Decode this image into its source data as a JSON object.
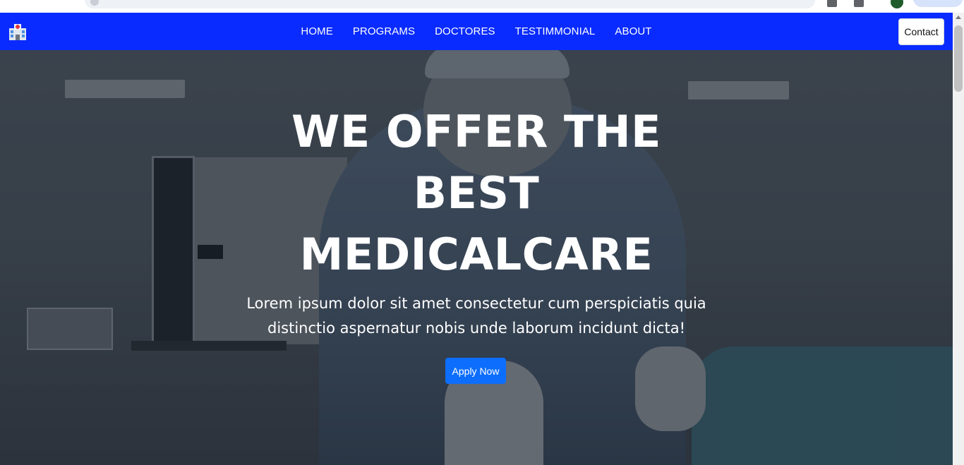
{
  "navbar": {
    "brand_icon": "hospital-icon",
    "links": [
      "HOME",
      "PROGRAMS",
      "DOCTORES",
      "TESTIMMONIAL",
      "ABOUT"
    ],
    "contact_label": "Contact",
    "background": "#0a2bff"
  },
  "hero": {
    "title": "WE OFFER THE BEST MEDICALCARE",
    "text": "Lorem ipsum dolor sit amet consectetur cum perspiciatis quia distinctio aspernatur nobis unde laborum incidunt dicta!",
    "apply_label": "Apply Now",
    "button_color": "#0d6efd"
  }
}
